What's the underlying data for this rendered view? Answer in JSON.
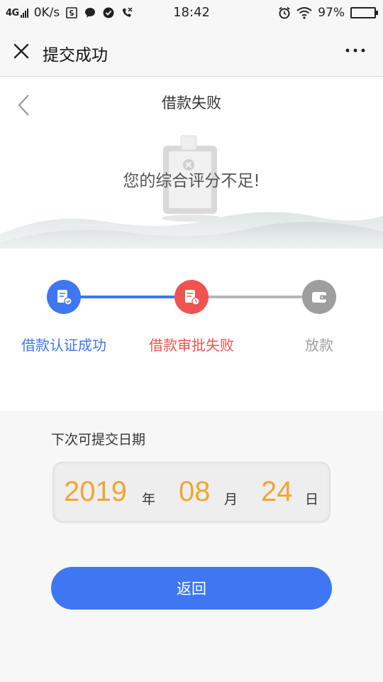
{
  "status_bar": {
    "network": "4G",
    "speed": "0K/s",
    "time": "18:42",
    "battery_percent": "97%",
    "battery_level": 0.97
  },
  "title_bar": {
    "title": "提交成功"
  },
  "page": {
    "title": "借款失败",
    "message": "您的综合评分不足!"
  },
  "steps": [
    {
      "label": "借款认证成功",
      "state": "done",
      "color": "#3f76f1"
    },
    {
      "label": "借款审批失败",
      "state": "failed",
      "color": "#ef5350"
    },
    {
      "label": "放款",
      "state": "pending",
      "color": "#9e9e9e"
    }
  ],
  "next_date": {
    "label": "下次可提交日期",
    "year": "2019",
    "year_unit": "年",
    "month": "08",
    "month_unit": "月",
    "day": "24",
    "day_unit": "日"
  },
  "actions": {
    "return_label": "返回"
  },
  "colors": {
    "primary": "#3f76f1",
    "danger": "#ef5350",
    "muted": "#9e9e9e",
    "date_accent": "#f0a631"
  },
  "icons": {
    "close": "close-icon",
    "more": "more-icon",
    "back": "chevron-left-icon"
  }
}
